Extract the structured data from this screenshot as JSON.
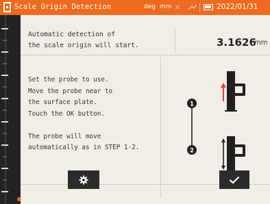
{
  "titlebar": {
    "title": "Scale Origin Detection",
    "unit_deg": "deg",
    "unit_mm": "mm",
    "date": "2022/01/31"
  },
  "header": {
    "message": "Automatic detection of\nthe scale origin will start.",
    "value": "3.1626",
    "unit": "mm"
  },
  "instructions": {
    "text": "Set the probe to use.\nMove the probe near to\nthe surface plate.\nTouch the OK button.\n\nThe probe will move\nautomatically as in STEP 1-2."
  },
  "diagram": {
    "steps": [
      "1",
      "2"
    ]
  },
  "toolbar": {
    "settings_icon": "gear-icon",
    "ok_icon": "checkmark-icon"
  },
  "colors": {
    "accent": "#ee6a1e",
    "panel": "#f1eee7",
    "arrow": "#e83a3a"
  }
}
